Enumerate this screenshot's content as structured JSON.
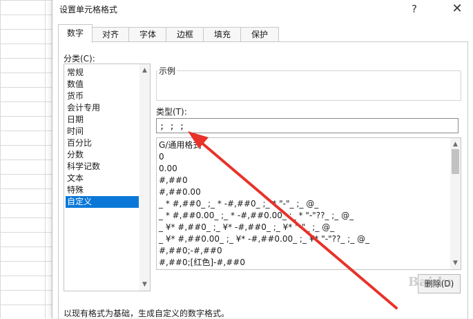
{
  "dialog": {
    "title": "设置单元格格式",
    "help_icon": "?",
    "close_icon": "✕"
  },
  "tabs": [
    {
      "label": "数字",
      "active": true
    },
    {
      "label": "对齐"
    },
    {
      "label": "字体"
    },
    {
      "label": "边框"
    },
    {
      "label": "填充"
    },
    {
      "label": "保护"
    }
  ],
  "category": {
    "label": "分类(C):",
    "items": [
      "常规",
      "数值",
      "货币",
      "会计专用",
      "日期",
      "时间",
      "百分比",
      "分数",
      "科学记数",
      "文本",
      "特殊",
      "自定义"
    ],
    "selected": "自定义"
  },
  "sample": {
    "label": "示例",
    "value": ""
  },
  "type_field": {
    "label": "类型(T):",
    "value": "; ; ;"
  },
  "format_list": [
    "G/通用格式",
    "0",
    "0.00",
    "#,##0",
    "#,##0.00",
    "_ * #,##0_ ;_ * -#,##0_ ;_ * \"-\"_ ;_ @_",
    "_ * #,##0.00_ ;_ * -#,##0.00_ ;_ * \"-\"??_ ;_ @_",
    "_ ¥* #,##0_ ;_ ¥* -#,##0_ ;_ ¥* \"-\"_ ;_ @_",
    "_ ¥* #,##0.00_ ;_ ¥* -#,##0.00_ ;_ ¥* \"-\"??_ ;_ @_",
    "#,##0;-#,##0",
    "#,##0;[红色]-#,##0"
  ],
  "delete_button": "删除(D)",
  "description": "以现有格式为基础，生成自定义的数字格式。",
  "watermark": "Baidu",
  "colors": {
    "selection": "#0b78d7",
    "annotation_arrow": "#e8322a"
  }
}
